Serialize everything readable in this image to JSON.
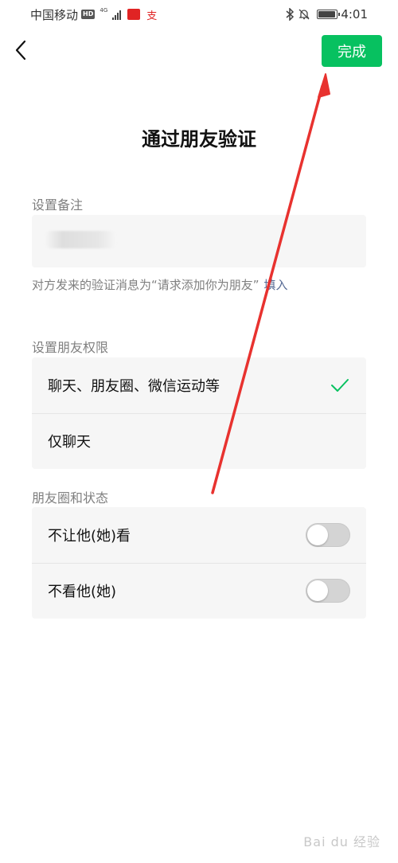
{
  "status_bar": {
    "carrier": "中国移动",
    "hd_badge": "HD",
    "network": "4G",
    "right_icons": [
      "bluetooth-icon",
      "mute-bell-icon",
      "battery-icon"
    ],
    "battery_level": 0.85,
    "time": "4:01"
  },
  "nav": {
    "back_icon": "chevron-left-icon",
    "done_label": "完成",
    "done_color": "#07c160"
  },
  "page_title": "通过朋友验证",
  "remark": {
    "label": "设置备注",
    "hint_text": "对方发来的验证消息为“请求添加你为朋友”",
    "fill_link": "填入",
    "link_color": "#576b95"
  },
  "permissions": {
    "label": "设置朋友权限",
    "options": [
      {
        "label": "聊天、朋友圈、微信运动等",
        "selected": true
      },
      {
        "label": "仅聊天",
        "selected": false
      }
    ],
    "check_color": "#07c160"
  },
  "moments": {
    "label": "朋友圈和状态",
    "toggles": [
      {
        "label": "不让他(她)看",
        "on": false
      },
      {
        "label": "不看他(她)",
        "on": false
      }
    ]
  },
  "watermark": "Bai du 经验"
}
